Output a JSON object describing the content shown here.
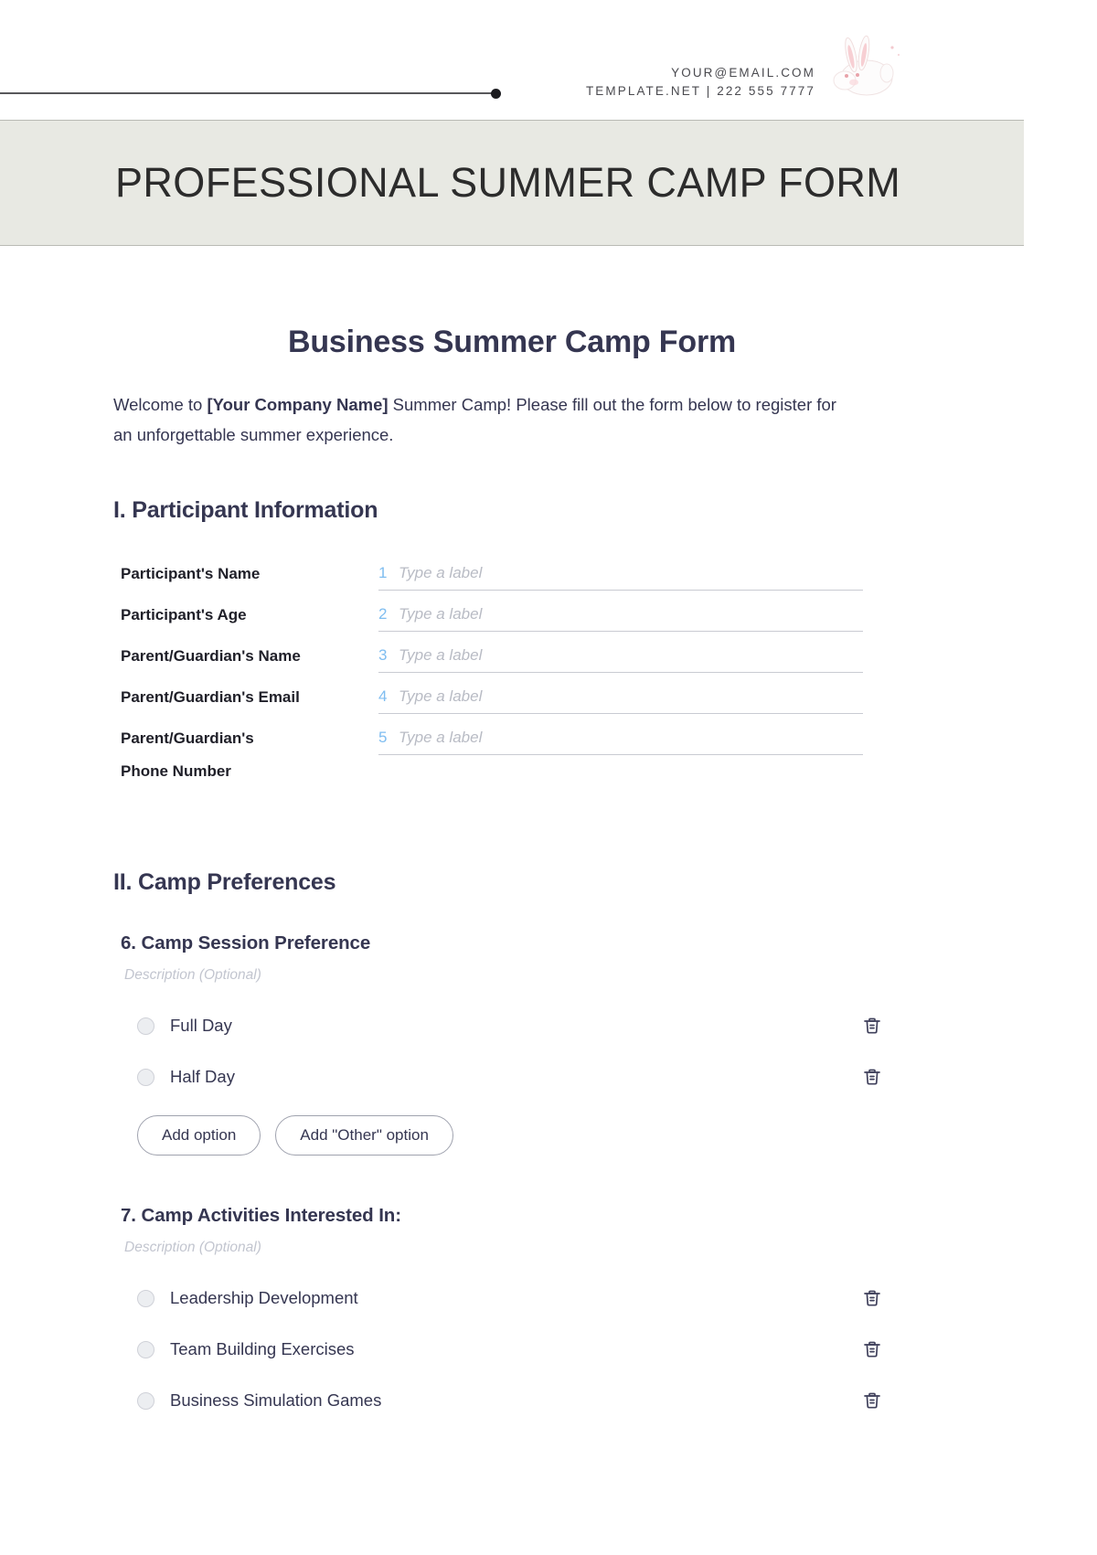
{
  "letterhead": {
    "email": "YOUR@EMAIL.COM",
    "site_phone": "TEMPLATE.NET | 222 555 7777",
    "logo_icon": "rabbit-illustration"
  },
  "banner": {
    "title": "PROFESSIONAL SUMMER CAMP FORM",
    "background": "#e8e9e3"
  },
  "document": {
    "title": "Business Summer Camp Form",
    "intro_prefix": "Welcome to ",
    "intro_company": "[Your Company Name]",
    "intro_suffix": " Summer Camp! Please fill out the form below to register for an unforgettable summer experience."
  },
  "sections": [
    {
      "heading": "I. Participant Information",
      "fields": [
        {
          "label": "Participant's Name",
          "label_line2": "",
          "number": "1",
          "placeholder": "Type a label",
          "value": ""
        },
        {
          "label": "Participant's Age",
          "label_line2": "",
          "number": "2",
          "placeholder": "Type a label",
          "value": ""
        },
        {
          "label": "Parent/Guardian's Name",
          "label_line2": "",
          "number": "3",
          "placeholder": "Type a label",
          "value": ""
        },
        {
          "label": "Parent/Guardian's Email",
          "label_line2": "",
          "number": "4",
          "placeholder": "Type a label",
          "value": ""
        },
        {
          "label": "Parent/Guardian's",
          "label_line2": "Phone Number",
          "number": "5",
          "placeholder": "Type a label",
          "value": ""
        }
      ]
    },
    {
      "heading": "II. Camp Preferences",
      "questions": [
        {
          "title": "6. Camp Session Preference",
          "description": "Description (Optional)",
          "options": [
            {
              "label": "Full Day",
              "delete_icon": "trash-icon"
            },
            {
              "label": "Half Day",
              "delete_icon": "trash-icon"
            }
          ],
          "add_option_label": "Add option",
          "add_other_label": "Add \"Other\" option"
        },
        {
          "title": "7. Camp Activities Interested In:",
          "description": "Description (Optional)",
          "options": [
            {
              "label": "Leadership Development",
              "delete_icon": "trash-icon"
            },
            {
              "label": "Team Building Exercises",
              "delete_icon": "trash-icon"
            },
            {
              "label": "Business Simulation Games",
              "delete_icon": "trash-icon"
            }
          ]
        }
      ]
    }
  ],
  "colors": {
    "heading": "#353651",
    "number_accent": "#7fbdf0",
    "placeholder": "#b8bbc4",
    "banner_bg": "#e8e9e3"
  }
}
